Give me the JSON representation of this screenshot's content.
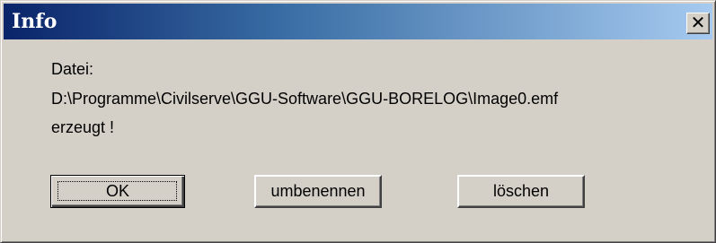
{
  "window": {
    "title": "Info",
    "close_glyph": "✕"
  },
  "message": {
    "line1": "Datei:",
    "line2": "D:\\Programme\\Civilserve\\GGU-Software\\GGU-BORELOG\\Image0.emf",
    "line3": "erzeugt !"
  },
  "buttons": {
    "ok": "OK",
    "rename": "umbenennen",
    "delete": "löschen"
  },
  "colors": {
    "title_gradient_start": "#0a246a",
    "title_gradient_end": "#a6caf0",
    "dialog_face": "#d4d0c8"
  }
}
